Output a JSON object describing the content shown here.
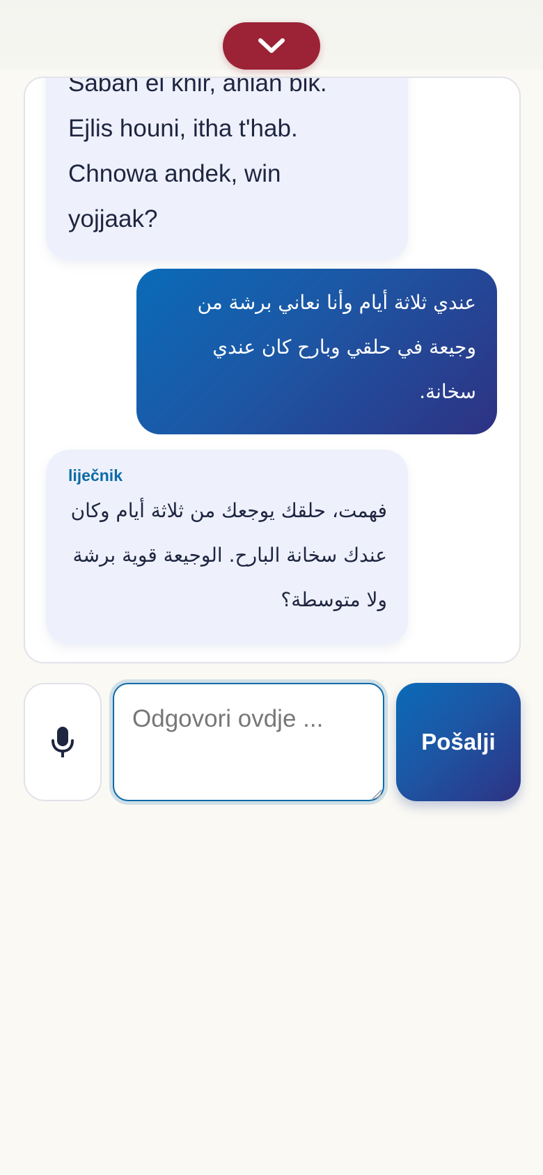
{
  "header": {
    "collapse_icon": "chevron-down-icon",
    "collapse_color": "#9b2335"
  },
  "chat": {
    "messages": [
      {
        "role": "doctor",
        "lines": [
          "Saban el khir, ahlan bik.",
          "Ejlis houni, itha t'hab.",
          "Chnowa andek, win",
          "yojjaak?"
        ]
      },
      {
        "role": "patient",
        "lines": [
          "عندي ثلاثة أيام وأنا نعاني برشة من",
          "وجيعة في حلقي وبارح كان عندي",
          "سخانة."
        ]
      },
      {
        "role": "doctor",
        "sender": "liječnik",
        "lines": [
          "فهمت، حلقك يوجعك من ثلاثة أيام وكان",
          "عندك سخانة البارح. الوجيعة قوية برشة",
          "ولا متوسطة؟"
        ]
      }
    ]
  },
  "composer": {
    "mic_icon": "microphone-icon",
    "placeholder": "Odgovori ovdje ...",
    "value": "",
    "send_label": "Pošalji"
  },
  "colors": {
    "accent": "#0b6aa8",
    "patient_gradient_start": "#0a6bb8",
    "patient_gradient_end": "#2e3283",
    "doctor_bubble": "#eef1fb",
    "background": "#faf9f4"
  }
}
